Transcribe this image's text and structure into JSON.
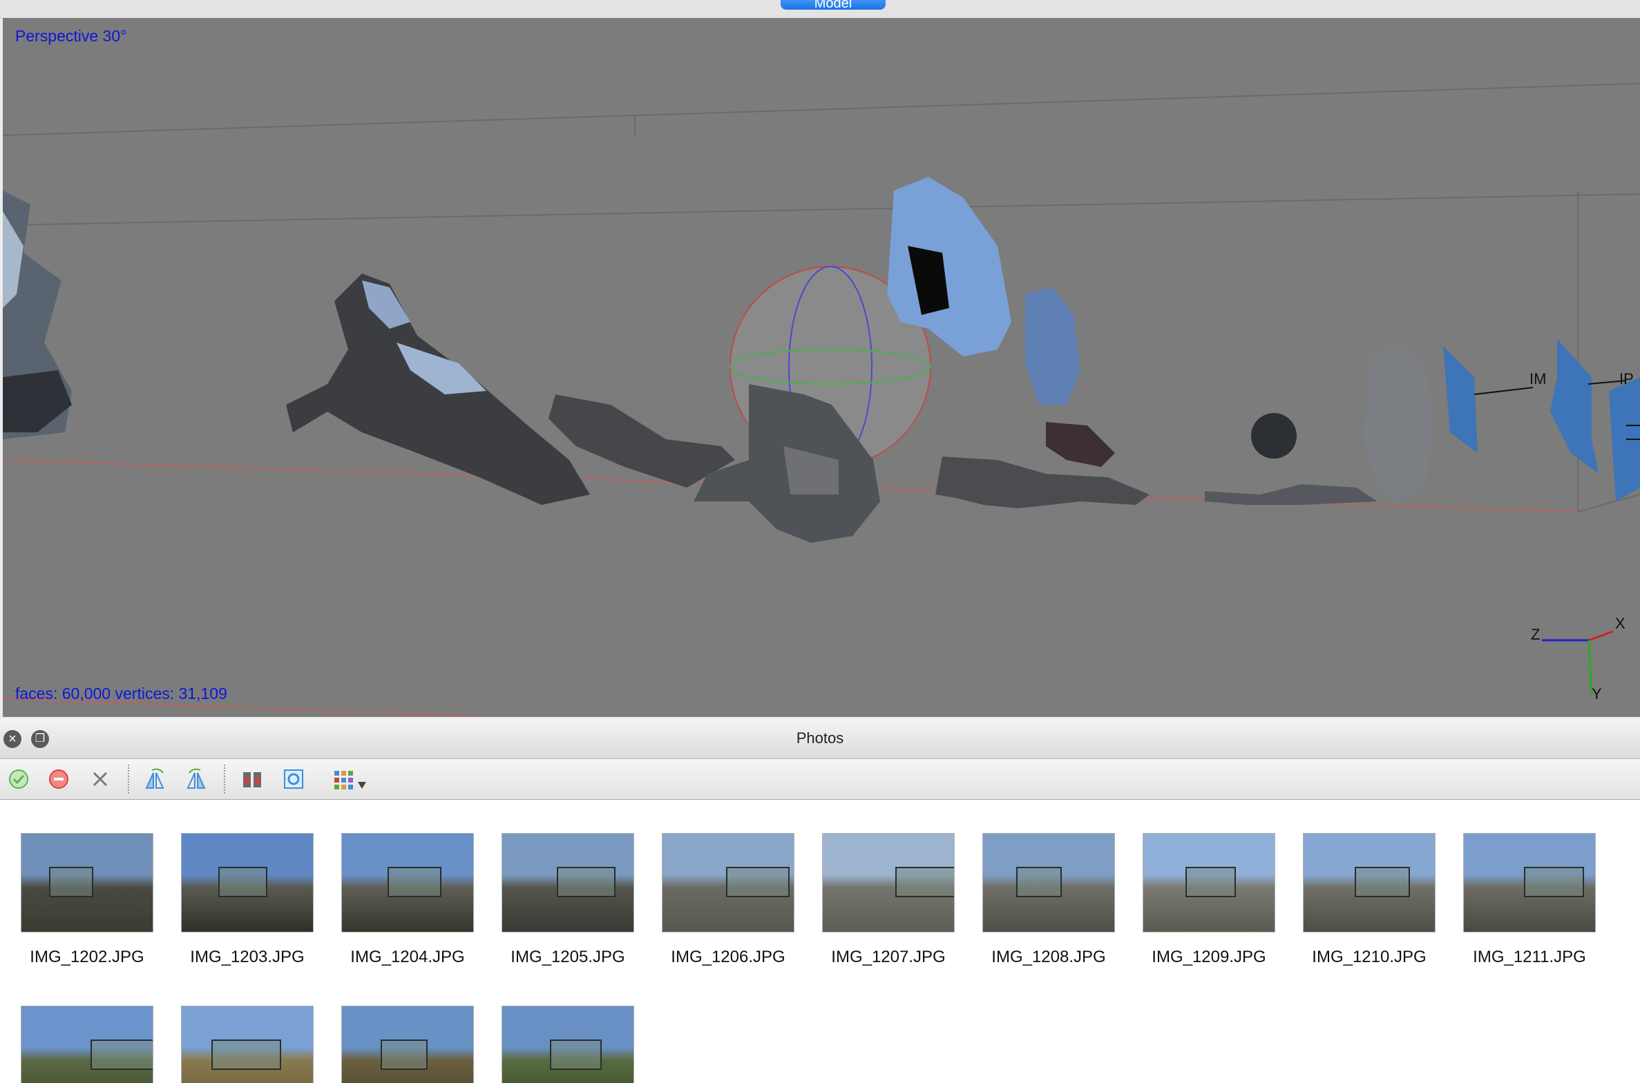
{
  "window": {
    "model_tab_label": "Model"
  },
  "viewport": {
    "view_label": "Perspective 30°",
    "stats_label": "faces: 60,000 vertices: 31,109",
    "camera_label_1": "IM",
    "camera_label_2": "IP",
    "axes": {
      "x": "X",
      "y": "Y",
      "z": "Z"
    }
  },
  "photos_panel": {
    "title": "Photos",
    "toolbar": [
      {
        "name": "enable-icon",
        "color": "#58b84a"
      },
      {
        "name": "disable-icon",
        "color": "#e0433a"
      },
      {
        "name": "remove-icon",
        "color": "#7a7a7a"
      },
      {
        "name": "rotate-right-icon",
        "color": "#3f8ed8"
      },
      {
        "name": "rotate-left-icon",
        "color": "#3f8ed8"
      },
      {
        "name": "filter-cameras-icon",
        "color": "#b03a3a"
      },
      {
        "name": "show-image-icon",
        "color": "#3f8ed8"
      },
      {
        "name": "view-mode-icon",
        "color": "#3f8ed8"
      }
    ],
    "photos": [
      {
        "label": "IMG_1202.JPG"
      },
      {
        "label": "IMG_1203.JPG"
      },
      {
        "label": "IMG_1204.JPG"
      },
      {
        "label": "IMG_1205.JPG"
      },
      {
        "label": "IMG_1206.JPG"
      },
      {
        "label": "IMG_1207.JPG"
      },
      {
        "label": "IMG_1208.JPG"
      },
      {
        "label": "IMG_1209.JPG"
      },
      {
        "label": "IMG_1210.JPG"
      },
      {
        "label": "IMG_1211.JPG"
      },
      {
        "label": ""
      },
      {
        "label": ""
      },
      {
        "label": ""
      },
      {
        "label": ""
      }
    ]
  }
}
